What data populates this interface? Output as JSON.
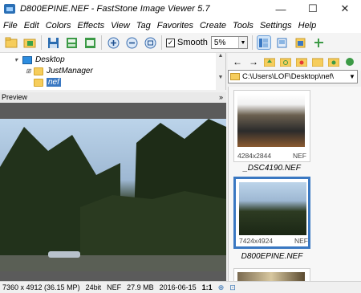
{
  "window": {
    "title": "D800EPINE.NEF - FastStone Image Viewer 5.7",
    "minimize": "—",
    "maximize": "☐",
    "close": "✕"
  },
  "menu": [
    "File",
    "Edit",
    "Colors",
    "Effects",
    "View",
    "Tag",
    "Favorites",
    "Create",
    "Tools",
    "Settings",
    "Help"
  ],
  "toolbar": {
    "smooth_label": "Smooth",
    "smooth_checked": "✓",
    "zoom_value": "5%"
  },
  "tree": {
    "items": [
      {
        "label": "Desktop"
      },
      {
        "label": "JustManager"
      },
      {
        "label": "nef"
      }
    ]
  },
  "preview": {
    "label": "Preview",
    "collapse": "»"
  },
  "browser": {
    "path": "C:\\Users\\LOF\\Desktop\\nef\\"
  },
  "thumbnails": [
    {
      "name": "_DSC4190.NEF",
      "dims": "4284x2844",
      "type": "NEF"
    },
    {
      "name": "D800EPINE.NEF",
      "dims": "7424x4924",
      "type": "NEF"
    }
  ],
  "status": {
    "dims": "7360 x 4912 (36.15 MP)",
    "bits": "24bit",
    "type": "NEF",
    "size": "27.9 MB",
    "date": "2016-06-15",
    "zoom": "1:1"
  },
  "colors": {
    "accent": "#3a78c2",
    "folder": "#f6cd5c",
    "desktop": "#2d8de0"
  }
}
